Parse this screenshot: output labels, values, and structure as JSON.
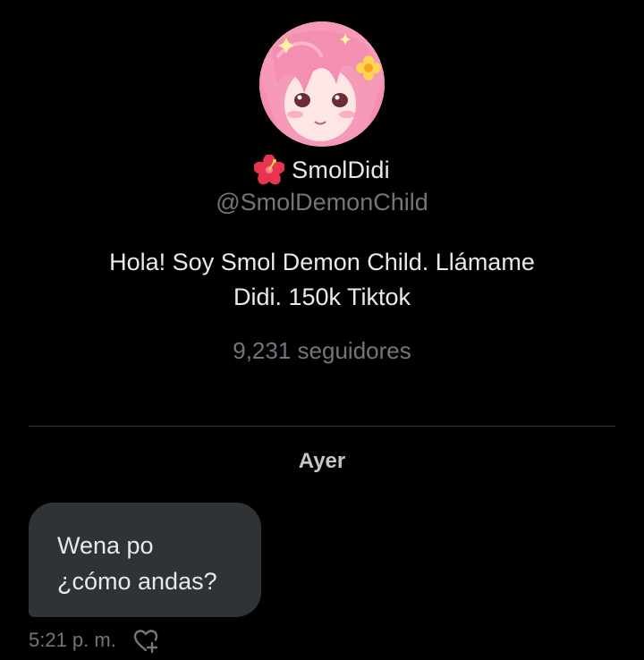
{
  "profile": {
    "display_name": "SmolDidi",
    "name_emoji": "hibiscus-icon",
    "handle": "@SmolDemonChild",
    "bio": "Hola! Soy Smol Demon Child. Llámame Didi. 150k Tiktok",
    "bio_lines": [
      "Hola! Soy Smol Demon Child. Llámame",
      "Didi. 150k Tiktok"
    ],
    "followers": "9,231 seguidores"
  },
  "conversation": {
    "date_label": "Ayer",
    "messages": [
      {
        "lines": [
          "Wena po",
          "¿cómo andas?"
        ],
        "time": "5:21 p. m.",
        "reaction_icon": "add-reaction-heart-icon"
      }
    ]
  },
  "colors": {
    "background": "#000000",
    "primary_text": "#e7e9ea",
    "secondary_text": "#71767b",
    "bubble": "#2f3336",
    "divider": "#2f3336",
    "avatar_hair": "#f59ab8"
  }
}
